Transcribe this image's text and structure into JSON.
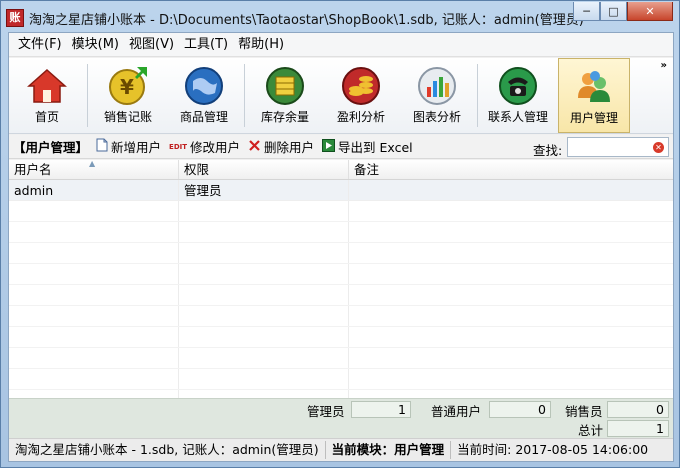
{
  "window": {
    "app_icon_text": "账",
    "title": "淘淘之星店铺小账本 - D:\\Documents\\Taotaostar\\ShopBook\\1.sdb,  记账人：admin(管理员)",
    "controls": {
      "minimize": "─",
      "maximize": "□",
      "close": "✕"
    }
  },
  "menu": {
    "items": [
      {
        "label": "文件(F)"
      },
      {
        "label": "模块(M)"
      },
      {
        "label": "视图(V)"
      },
      {
        "label": "工具(T)"
      },
      {
        "label": "帮助(H)"
      }
    ]
  },
  "toolbar": {
    "items": [
      {
        "label": "首页",
        "icon": "home-icon",
        "color": "#d8382a"
      },
      {
        "label": "销售记账",
        "icon": "yen-coin-icon",
        "color": "#e6c22a"
      },
      {
        "label": "商品管理",
        "icon": "globe-icon",
        "color": "#2a6fc0"
      },
      {
        "label": "库存余量",
        "icon": "stock-icon",
        "color": "#3a8a3a"
      },
      {
        "label": "盈利分析",
        "icon": "coins-icon",
        "color": "#c02a2a"
      },
      {
        "label": "图表分析",
        "icon": "bar-chart-icon",
        "color": "#9aa6b4"
      },
      {
        "label": "联系人管理",
        "icon": "phone-icon",
        "color": "#2a9a4a"
      },
      {
        "label": "用户管理",
        "icon": "users-icon",
        "color": "#e08a2a"
      }
    ],
    "overflow": "»"
  },
  "actionbar": {
    "title": "【用户管理】",
    "new_user": "新增用户",
    "edit_badge": "EDIT",
    "edit_user": "修改用户",
    "delete_user": "删除用户",
    "export": "导出到 Excel",
    "search_label": "查找:",
    "search_value": ""
  },
  "grid": {
    "columns": [
      "用户名",
      "权限",
      "备注"
    ],
    "rows": [
      {
        "username": "admin",
        "role": "管理员",
        "note": ""
      }
    ]
  },
  "summary": {
    "admin_label": "管理员",
    "admin_count": "1",
    "normal_label": "普通用户",
    "normal_count": "0",
    "sales_label": "销售员",
    "sales_count": "0",
    "total_label": "总计",
    "total_count": "1"
  },
  "status": {
    "file": "淘淘之星店铺小账本 - 1.sdb, 记账人：admin(管理员)",
    "module": "当前模块：用户管理",
    "time": "当前时间: 2017-08-05 14:06:00"
  }
}
